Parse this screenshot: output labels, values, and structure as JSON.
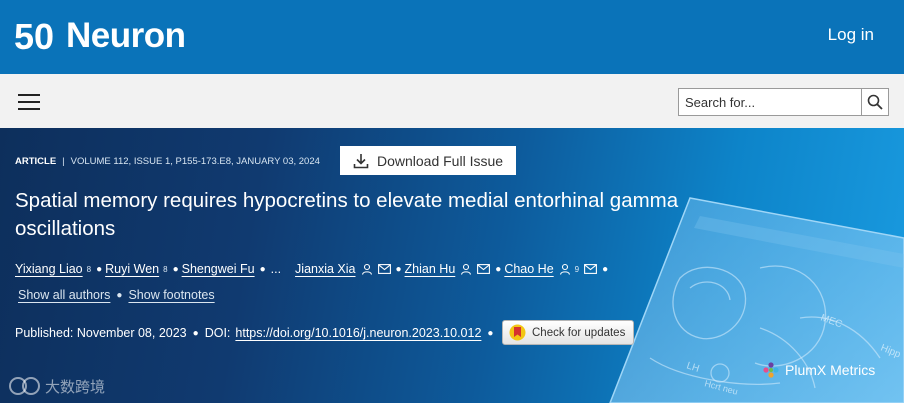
{
  "brand": {
    "logo_number": "50",
    "logo_text": "Neuron",
    "login_label": "Log in"
  },
  "nav": {
    "search_placeholder": "Search for..."
  },
  "article": {
    "type": "ARTICLE",
    "citation": "VOLUME 112, ISSUE 1, P155-173.E8, JANUARY 03, 2024",
    "download_label": "Download Full Issue",
    "title": "Spatial memory requires hypocretins to elevate medial entorhinal gamma oscillations",
    "authors": [
      {
        "name": "Yixiang Liao",
        "sup": "8"
      },
      {
        "name": "Ruyi Wen",
        "sup": "8"
      },
      {
        "name": "Shengwei Fu",
        "sup": ""
      },
      {
        "ellipsis": "..."
      },
      {
        "name": "Jianxia Xia",
        "sup": ""
      },
      {
        "name": "Zhian Hu",
        "sup": ""
      },
      {
        "name": "Chao He",
        "sup": "9"
      }
    ],
    "show_all_authors": "Show all authors",
    "show_footnotes": "Show footnotes",
    "published": "Published: November 08, 2023",
    "doi_label": "DOI:",
    "doi": "https://doi.org/10.1016/j.neuron.2023.10.012",
    "check_updates_label": "Check for updates",
    "plumx_label": "PlumX Metrics"
  },
  "figure_labels": {
    "mec": "MEC",
    "lh": "LH",
    "hip": "Hipp",
    "hcrt": "Hcrt neu"
  },
  "watermark": "大数跨境",
  "colors": {
    "brand_blue": "#0a73b9",
    "nav_gray": "#f2f2f2",
    "hero_dark": "#0d2f5c",
    "hero_light": "#1a9be0"
  }
}
